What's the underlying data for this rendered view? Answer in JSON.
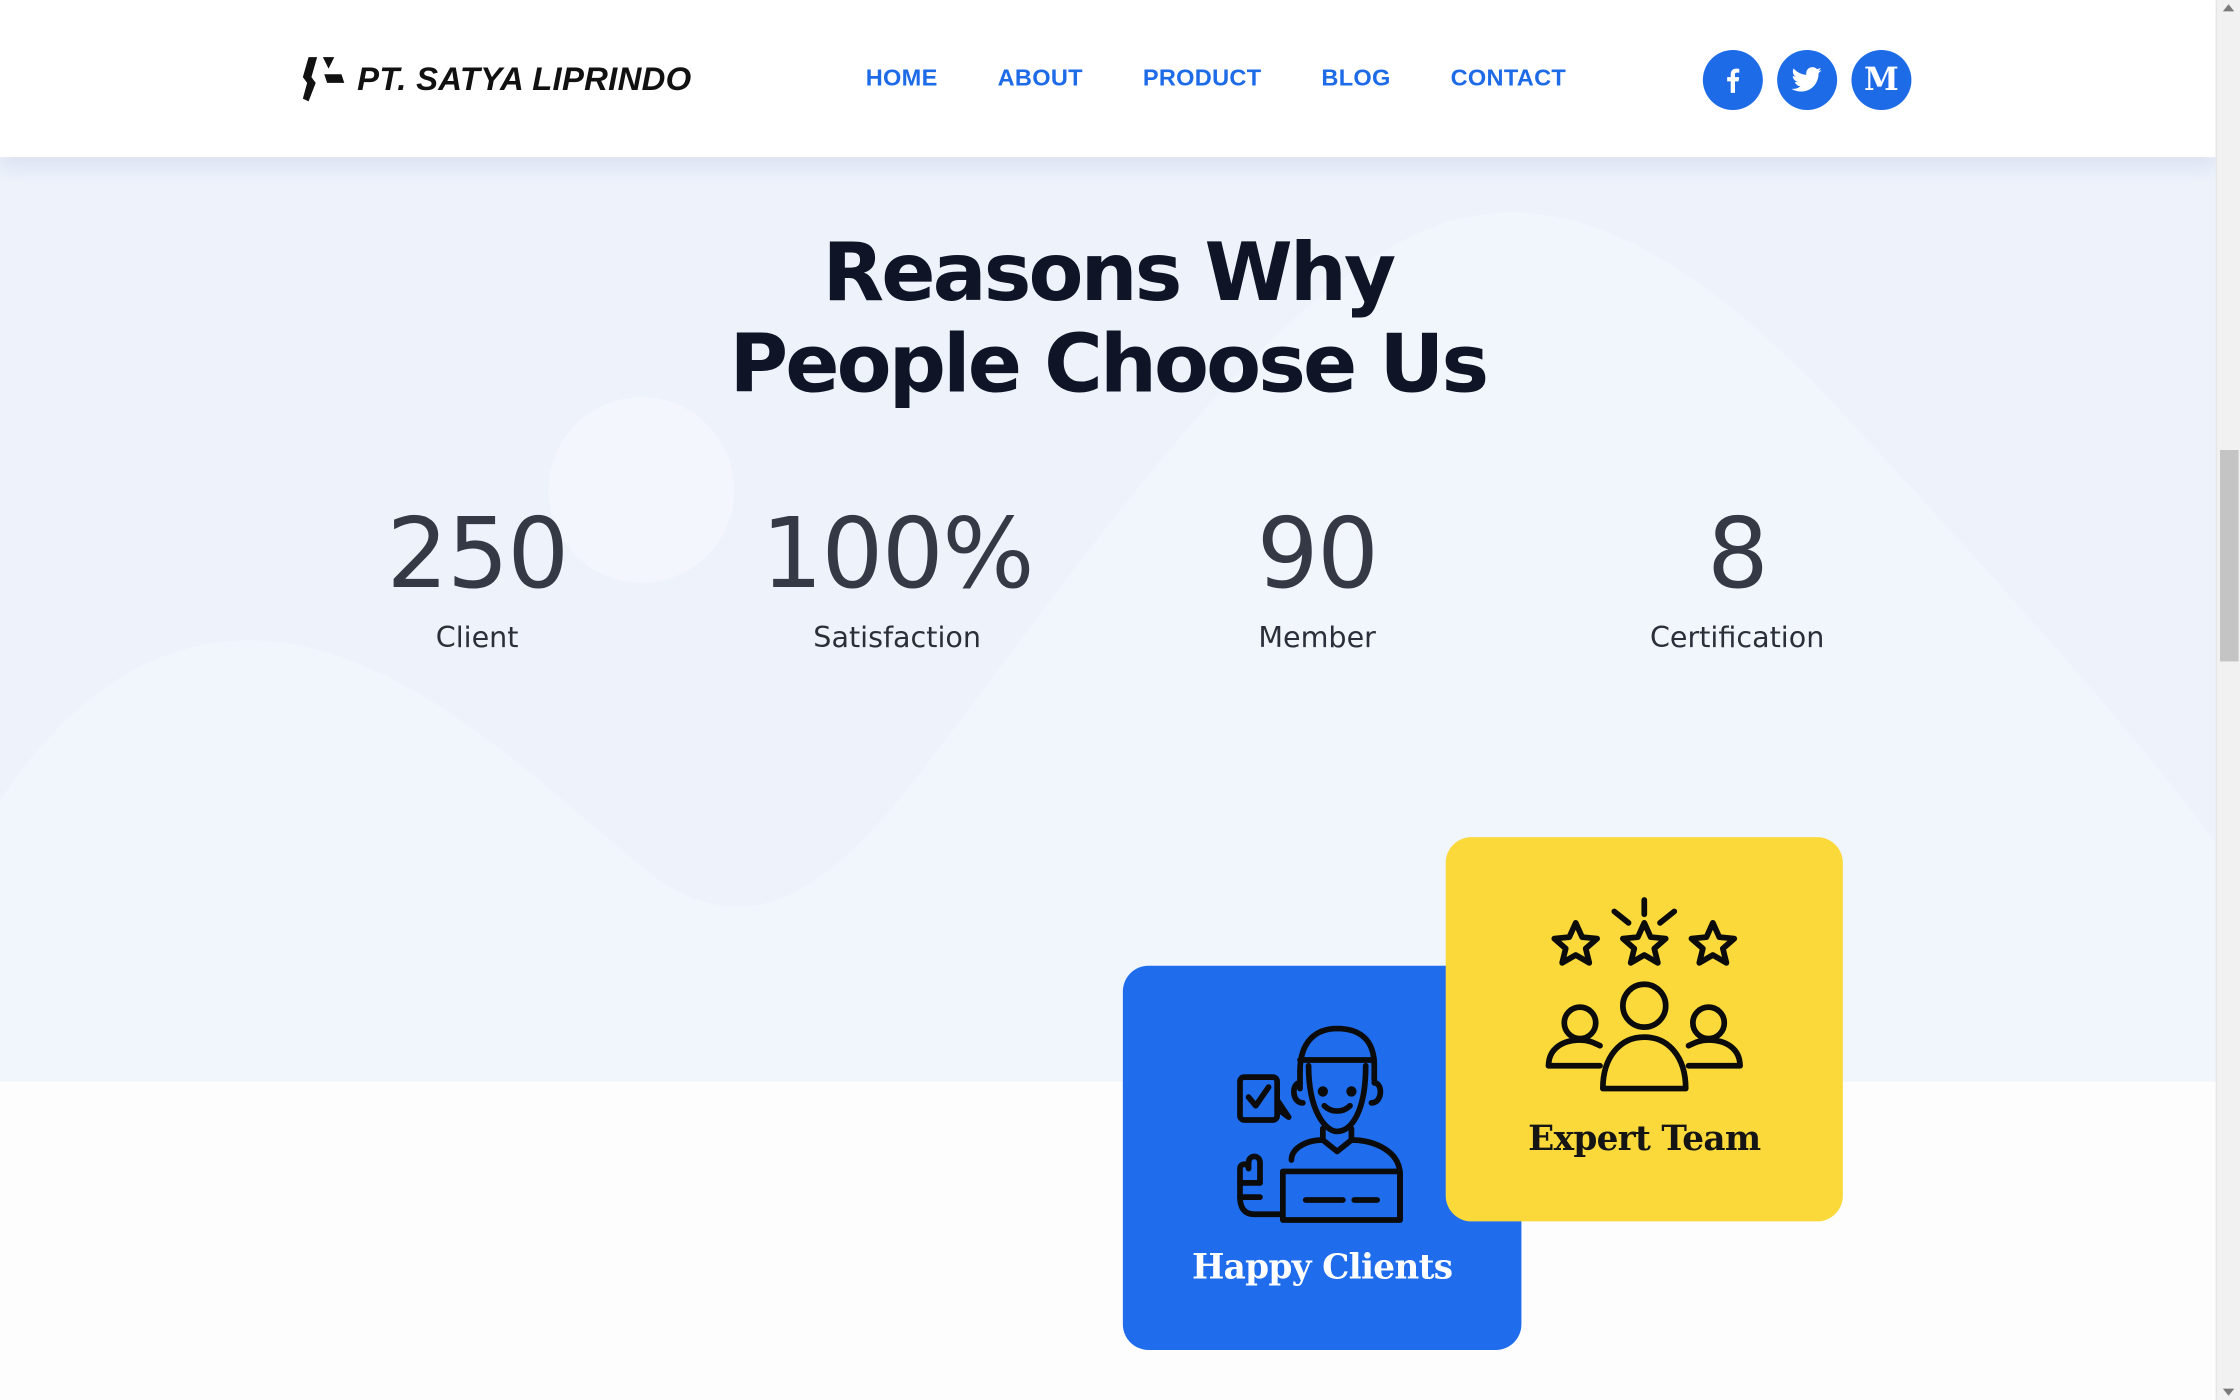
{
  "header": {
    "brand": "PT. SATYA LIPRINDO",
    "nav": [
      "HOME",
      "ABOUT",
      "PRODUCT",
      "BLOG",
      "CONTACT"
    ],
    "social": [
      {
        "name": "facebook-icon",
        "glyph": "f"
      },
      {
        "name": "twitter-icon",
        "glyph": ""
      },
      {
        "name": "medium-icon",
        "glyph": "M"
      }
    ]
  },
  "section": {
    "title_line1": "Reasons Why",
    "title_line2": "People Choose Us"
  },
  "stats": [
    {
      "value": "250",
      "label": "Client"
    },
    {
      "value": "100%",
      "label": "Satisfaction"
    },
    {
      "value": "90",
      "label": "Member"
    },
    {
      "value": "8",
      "label": "Certification"
    }
  ],
  "cards": {
    "happy_clients": "Happy Clients",
    "expert_team": "Expert Team"
  },
  "colors": {
    "accent": "#1e6be8",
    "card_blue": "#1f6ded",
    "card_yellow": "#fbd93b",
    "heading": "#0f1426",
    "background": "#edf2fb"
  }
}
